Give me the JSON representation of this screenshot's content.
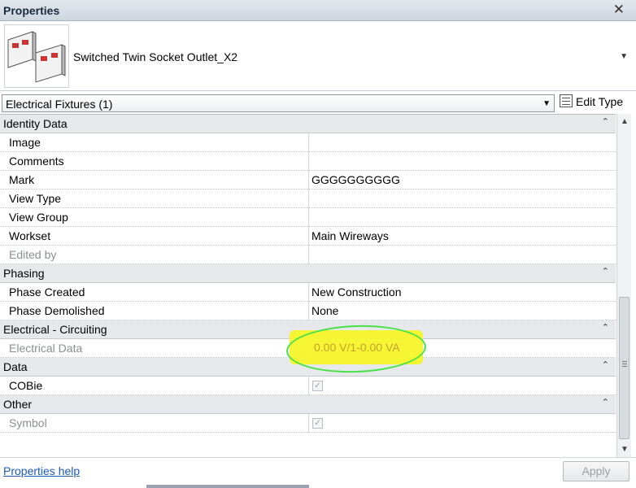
{
  "window": {
    "title": "Properties"
  },
  "type_selector": {
    "name": "Switched Twin Socket Outlet_X2"
  },
  "filter": {
    "selected": "Electrical Fixtures (1)",
    "edit_type_label": "Edit Type"
  },
  "groups": [
    {
      "label": "Identity Data"
    },
    {
      "label": "Phasing"
    },
    {
      "label": "Electrical - Circuiting"
    },
    {
      "label": "Data"
    },
    {
      "label": "Other"
    }
  ],
  "props": {
    "image": {
      "name": "Image",
      "value": ""
    },
    "comments": {
      "name": "Comments",
      "value": ""
    },
    "mark": {
      "name": "Mark",
      "value": "GGGGGGGGGG"
    },
    "view_type": {
      "name": "View Type",
      "value": ""
    },
    "view_group": {
      "name": "View Group",
      "value": ""
    },
    "workset": {
      "name": "Workset",
      "value": "Main Wireways"
    },
    "edited_by": {
      "name": "Edited by",
      "value": ""
    },
    "phase_created": {
      "name": "Phase Created",
      "value": "New Construction"
    },
    "phase_demolished": {
      "name": "Phase Demolished",
      "value": "None"
    },
    "electrical_data": {
      "name": "Electrical Data",
      "value": "0.00 V/1-0.00 VA"
    },
    "cobie": {
      "name": "COBie",
      "checked": true
    },
    "symbol": {
      "name": "Symbol",
      "checked": true
    }
  },
  "footer": {
    "help_link": "Properties help",
    "apply_label": "Apply"
  },
  "icons": {
    "close": "close-icon",
    "dropdown": "chevron-down-icon",
    "collapse": "double-chevron-up-icon",
    "edit_type": "edit-type-icon"
  },
  "colors": {
    "highlight": "#f6f62a",
    "annotation_circle": "#48e248",
    "link": "#1e5bb8"
  }
}
